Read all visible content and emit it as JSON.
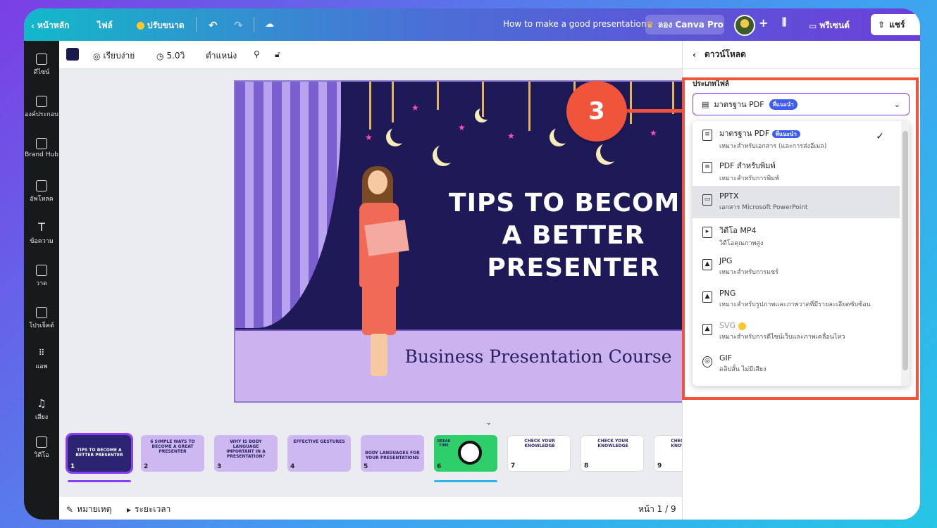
{
  "topbar": {
    "home": "หน้าหลัก",
    "file": "ไฟล์",
    "resize": "ปรับขนาด",
    "doc_title": "How to make a good presentation",
    "try_pro": "ลอง Canva Pro",
    "present": "พรีเซนต์",
    "share": "แชร์"
  },
  "rail": [
    "ดีไซน์",
    "องค์ประกอบ",
    "Brand Hub",
    "อัพโหลด",
    "ข้อความ",
    "วาด",
    "โปรเจ็คต์",
    "แอพ",
    "เสียง",
    "วิดีโอ"
  ],
  "toolbar": {
    "animate": "เรียบง่าย",
    "duration": "5.0วิ",
    "position": "ตำแหน่ง"
  },
  "slide": {
    "title_line1": "TIPS TO BECOME",
    "title_line2": "A BETTER PRESENTER",
    "subtitle": "Business Presentation Course"
  },
  "thumbs": [
    {
      "n": "1",
      "t": "TIPS TO BECOME A BETTER PRESENTER"
    },
    {
      "n": "2",
      "t": "6 SIMPLE WAYS TO BECOME A GREAT PRESENTER"
    },
    {
      "n": "3",
      "t": "WHY IS BODY LANGUAGE IMPORTANT IN A PRESENTATION?"
    },
    {
      "n": "4",
      "t": "EFFECTIVE GESTURES"
    },
    {
      "n": "5",
      "t": "BODY LANGUAGES FOR YOUR PRESENTATIONS"
    },
    {
      "n": "6",
      "t": "BREAK TIME"
    },
    {
      "n": "7",
      "t": "CHECK YOUR KNOWLEDGE"
    },
    {
      "n": "8",
      "t": "CHECK YOUR KNOWLEDGE"
    },
    {
      "n": "9",
      "t": "CHECK YOUR KNOWLEDGE"
    }
  ],
  "bottom": {
    "notes": "หมายเหตุ",
    "timer": "ระยะเวลา",
    "page": "หน้า 1 / 9"
  },
  "panel": {
    "back_title": "ดาวน์โหลด",
    "file_type_label": "ประเภทไฟล์",
    "selected": "มาตรฐาน PDF",
    "recommended": "ที่แนะนำ",
    "options": [
      {
        "title": "มาตรฐาน PDF",
        "desc": "เหมาะสำหรับเอกสาร (และการส่งอีเมล)",
        "icon": "document-icon"
      },
      {
        "title": "PDF สำหรับพิมพ์",
        "desc": "เหมาะสำหรับการพิมพ์",
        "icon": "document-icon"
      },
      {
        "title": "PPTX",
        "desc": "เอกสาร Microsoft PowerPoint",
        "icon": "presentation-icon"
      },
      {
        "title": "วิดีโอ MP4",
        "desc": "วิดีโอคุณภาพสูง",
        "icon": "video-icon"
      },
      {
        "title": "JPG",
        "desc": "เหมาะสำหรับการแชร์",
        "icon": "image-icon"
      },
      {
        "title": "PNG",
        "desc": "เหมาะสำหรับรูปภาพและภาพวาดที่มีรายละเอียดซับซ้อน",
        "icon": "image-icon"
      },
      {
        "title": "SVG",
        "desc": "เหมาะสำหรับการดีไซน์เว็บและภาพเคลื่อนไหว",
        "icon": "image-icon"
      },
      {
        "title": "GIF",
        "desc": "คลิปสั้น ไม่มีเสียง",
        "icon": "gif-icon"
      }
    ]
  },
  "callout": {
    "step": "3"
  },
  "colors": {
    "accent": "#8b3dff",
    "callout": "#f0543a"
  }
}
